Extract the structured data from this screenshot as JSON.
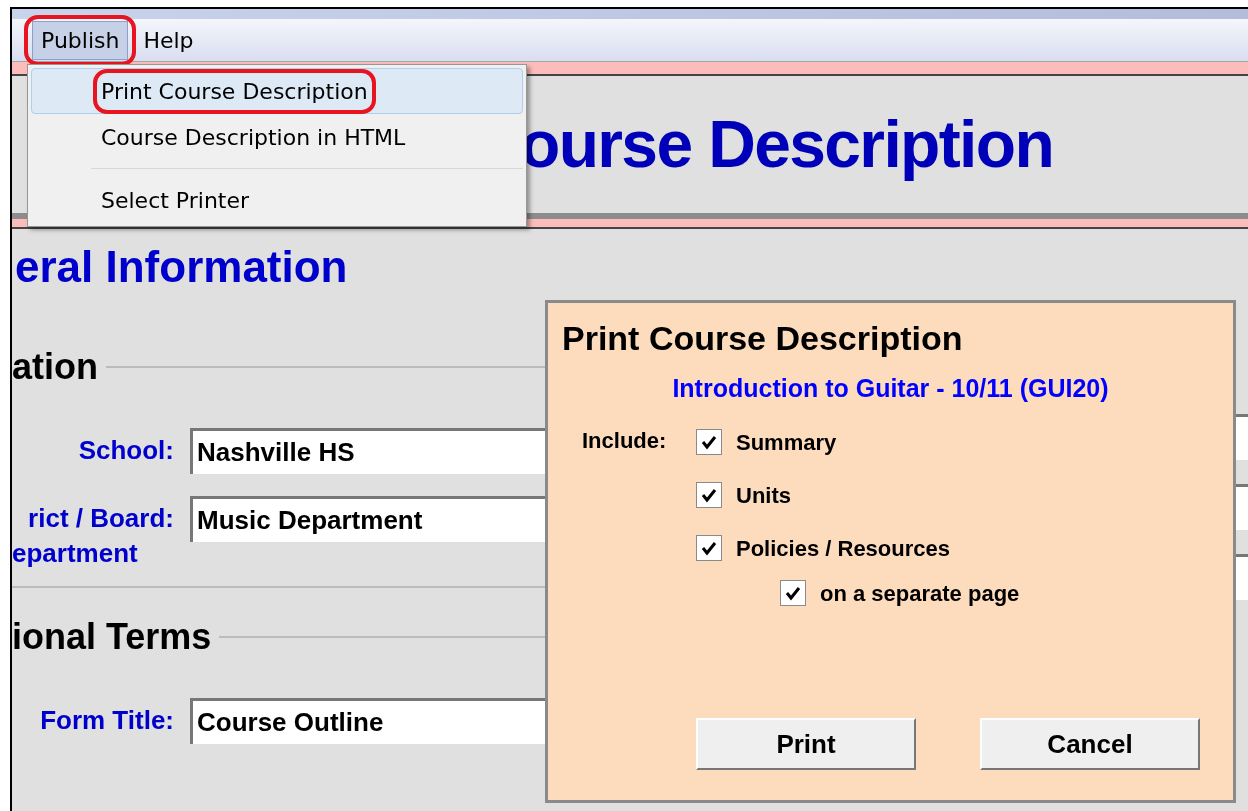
{
  "menu_bar": [
    {
      "label": "Publish",
      "selected": true,
      "circled": true
    },
    {
      "label": "Help",
      "selected": false,
      "circled": false
    }
  ],
  "menu": {
    "items": [
      {
        "label": "Print Course Description",
        "selected": true,
        "circled": true,
        "separator_after": false
      },
      {
        "label": "Course Description in HTML",
        "selected": false,
        "circled": false,
        "separator_after": true
      },
      {
        "label": "Select Printer",
        "selected": false,
        "circled": false,
        "separator_after": false
      }
    ]
  },
  "header": {
    "title": "ourse Description"
  },
  "page": {
    "heading": "eral Information",
    "sections": [
      {
        "title": "ation",
        "fields": [
          {
            "label": "School:",
            "value": "Nashville HS"
          },
          {
            "label": "rict / Board:",
            "sublabel": "epartment",
            "value": "Music Department"
          }
        ]
      },
      {
        "title": "ional Terms",
        "fields": [
          {
            "label": "Form Title:",
            "value": "Course Outline"
          }
        ]
      }
    ]
  },
  "dialog": {
    "title": "Print Course Description",
    "subtitle": "Introduction to Guitar - 10/11 (GUI20)",
    "include_label": "Include:",
    "options": [
      {
        "label": "Summary",
        "checked": true,
        "nested": false
      },
      {
        "label": "Units",
        "checked": true,
        "nested": false
      },
      {
        "label": "Policies / Resources",
        "checked": true,
        "nested": false
      },
      {
        "label": "on a separate page",
        "checked": true,
        "nested": true
      }
    ],
    "buttons": [
      "Print",
      "Cancel"
    ]
  }
}
